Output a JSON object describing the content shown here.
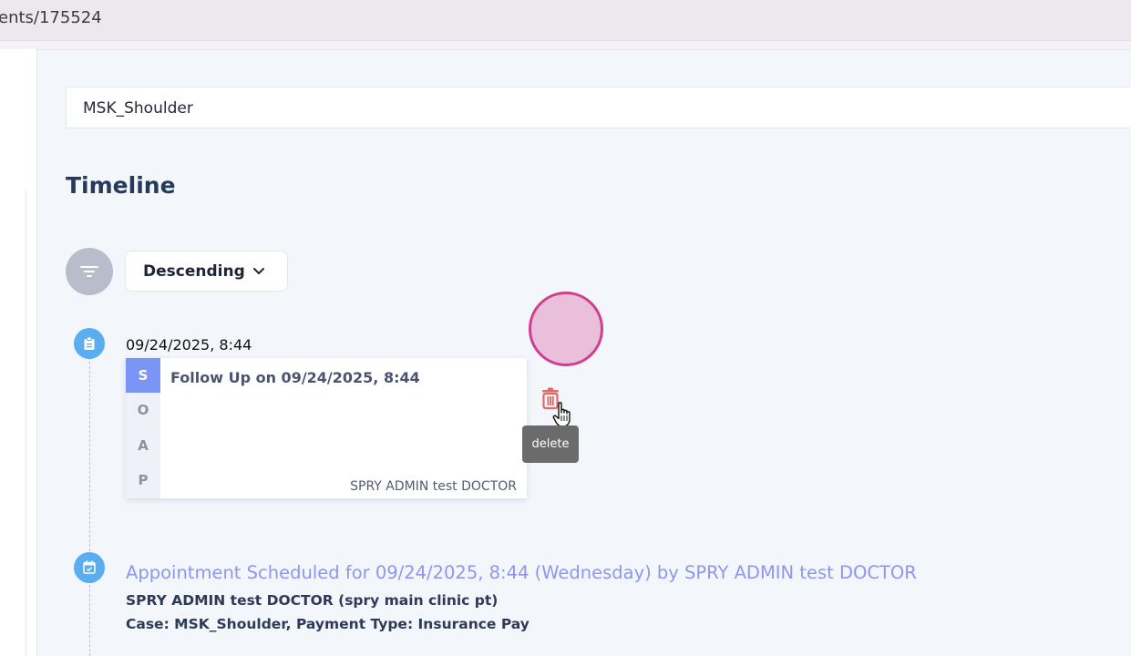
{
  "browser": {
    "url_fragment": "ents/175524"
  },
  "case": {
    "value": "MSK_Shoulder"
  },
  "timeline": {
    "title": "Timeline",
    "sort": {
      "selected": "Descending"
    },
    "entries": [
      {
        "datetime": "09/24/2025, 8:44",
        "icon": "clipboard-icon",
        "note": {
          "soap": [
            "S",
            "O",
            "A",
            "P"
          ],
          "active_section": "S",
          "title": "Follow Up on 09/24/2025, 8:44",
          "author": "SPRY ADMIN test DOCTOR"
        },
        "actions": {
          "delete_tooltip": "delete"
        }
      },
      {
        "icon": "calendar-check-icon",
        "title": "Appointment Scheduled for 09/24/2025, 8:44 (Wednesday) by SPRY ADMIN test DOCTOR",
        "provider": "SPRY ADMIN test DOCTOR (spry main clinic pt)",
        "details": "Case: MSK_Shoulder, Payment Type: Insurance Pay"
      }
    ]
  },
  "colors": {
    "accent": "#7a95f5",
    "timeline_dot": "#5aaef0",
    "delete": "#e06a6a",
    "click_indicator": "#cf3f8d"
  }
}
